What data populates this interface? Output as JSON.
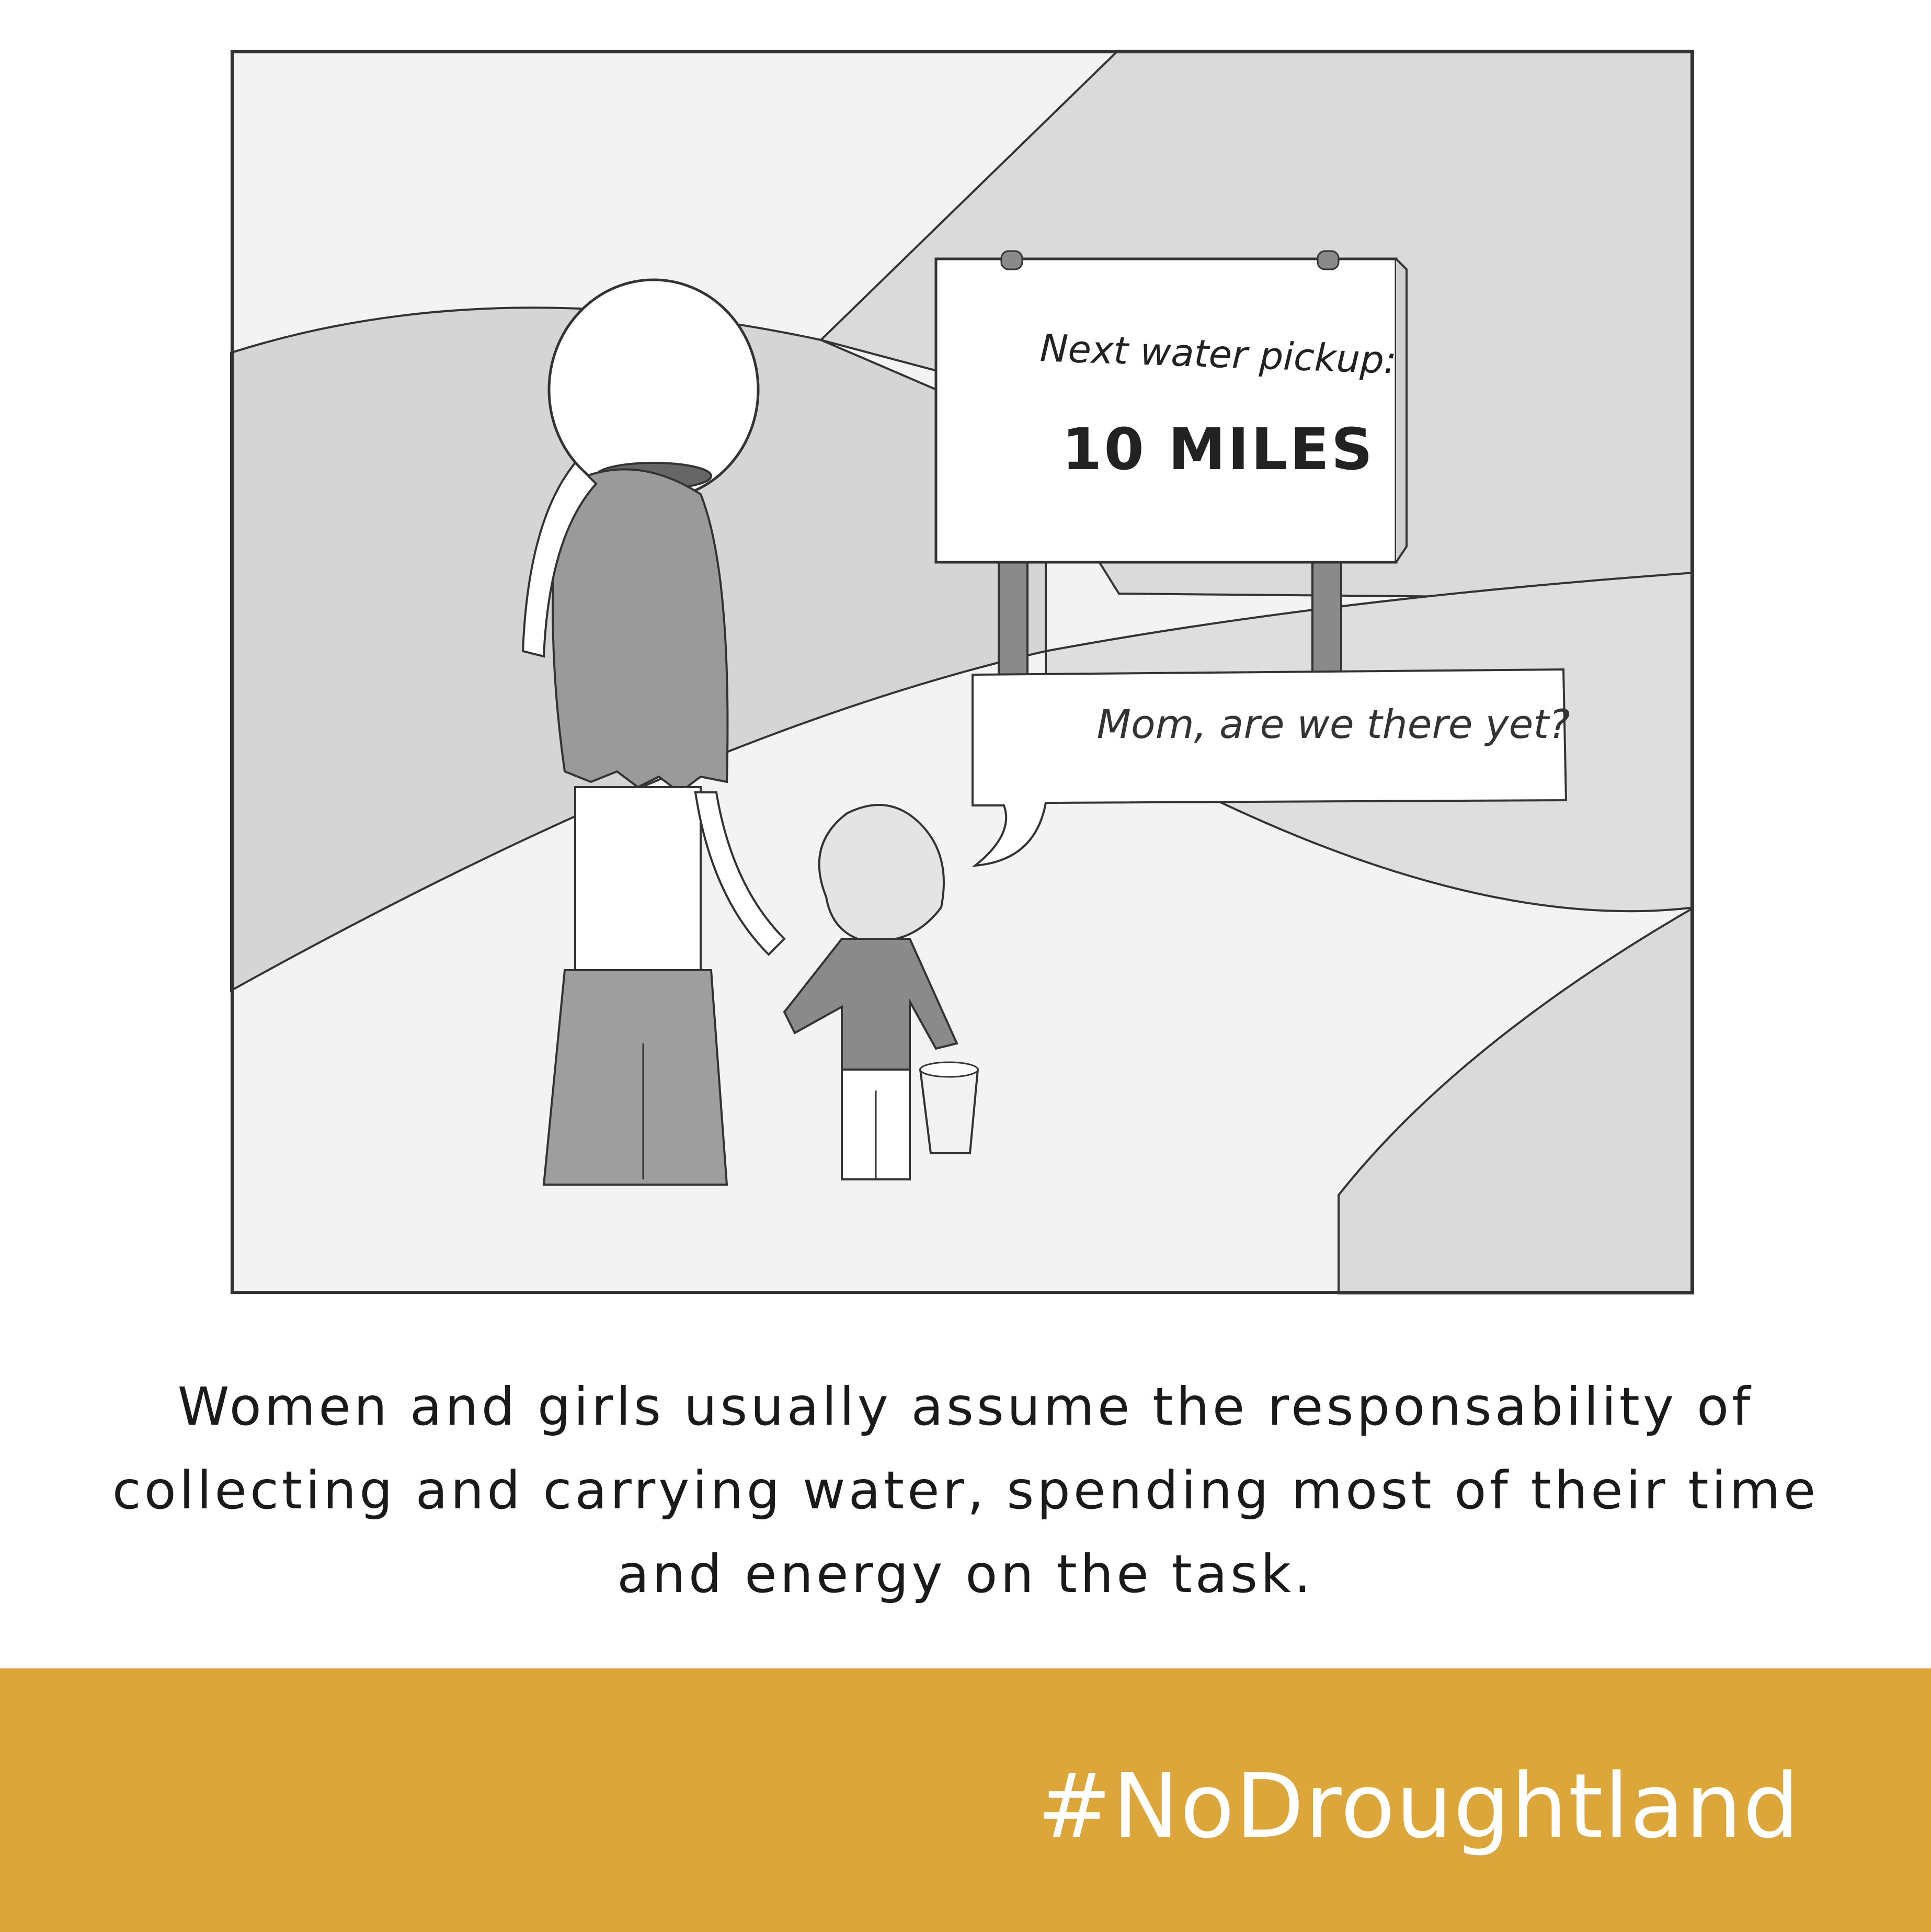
{
  "comic": {
    "sign": {
      "label": "Next water pickup:",
      "distance": "10 MILES"
    },
    "speech_bubble": "Mom, are we there yet?"
  },
  "caption": "Women and girls usually assume the responsability of collecting and carrying water, spending most of their time and energy on the task.",
  "footer": {
    "hashtag": "#NoDroughtland",
    "color": "#DCA63A"
  }
}
